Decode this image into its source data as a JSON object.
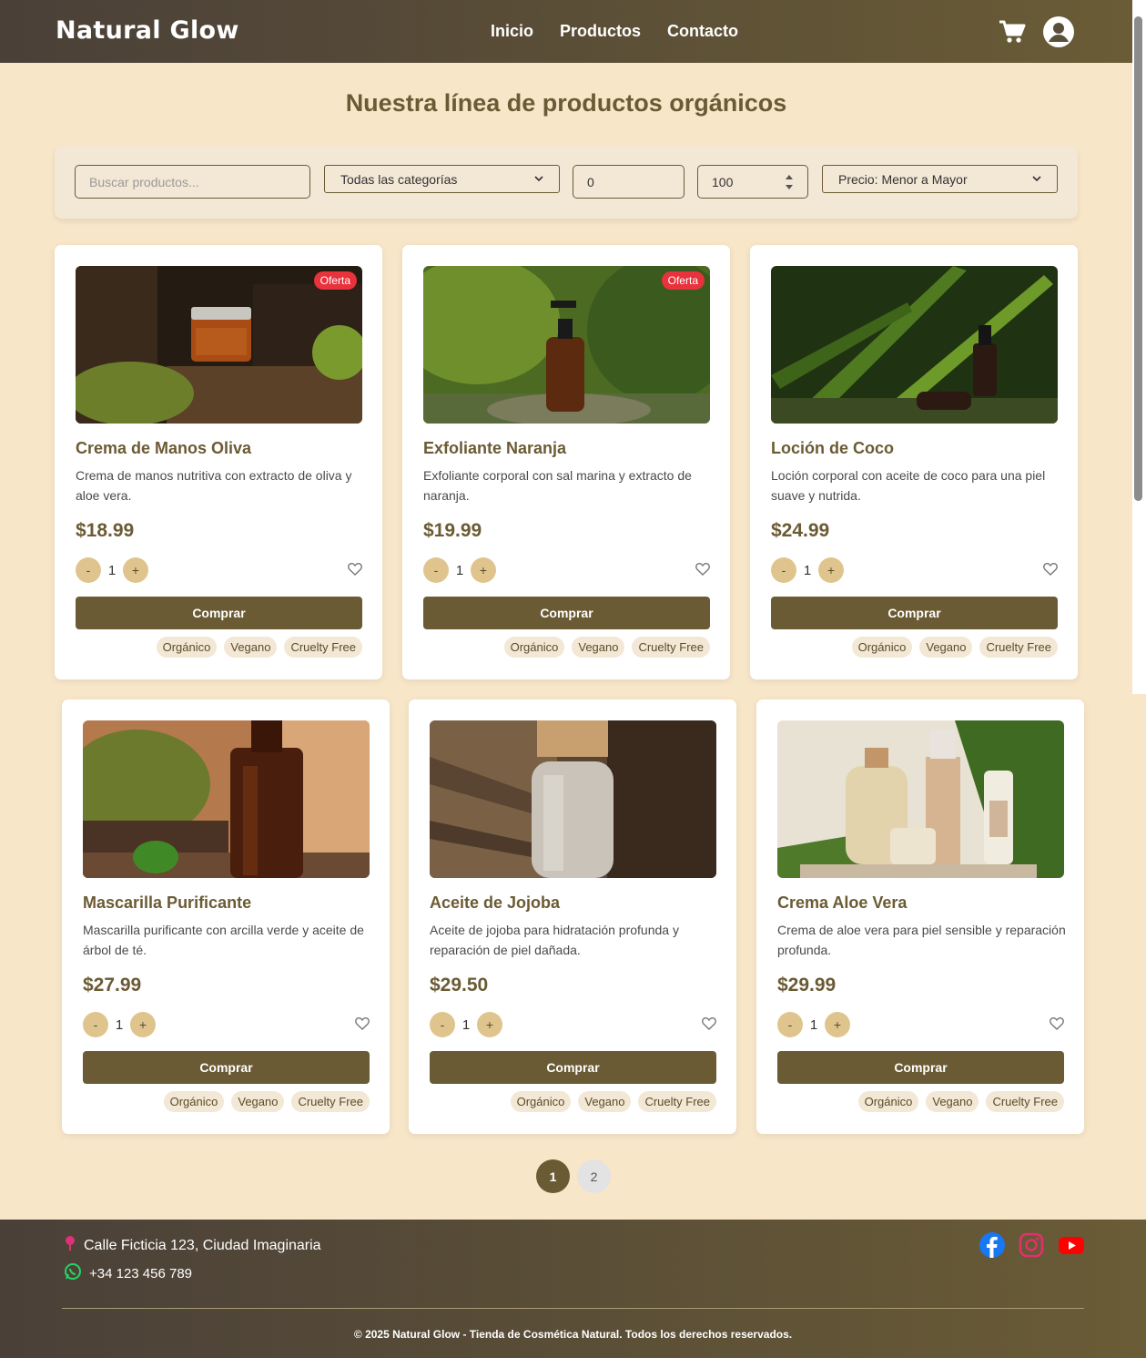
{
  "header": {
    "brand": "Natural Glow",
    "nav": [
      "Inicio",
      "Productos",
      "Contacto"
    ],
    "icons": [
      "cart-icon",
      "user-icon"
    ]
  },
  "page": {
    "title": "Nuestra línea de productos orgánicos"
  },
  "filters": {
    "search_placeholder": "Buscar productos...",
    "category_selected": "Todas las categorías",
    "price_min": "0",
    "price_max": "100",
    "sort_selected": "Precio: Menor a Mayor"
  },
  "products": [
    {
      "name": "Crema de Manos Oliva",
      "desc": "Crema de manos nutritiva con extracto de oliva y aloe vera.",
      "price": "$18.99",
      "qty": "1",
      "badge": "Oferta",
      "buy": "Comprar",
      "tags": [
        "Orgánico",
        "Vegano",
        "Cruelty Free"
      ]
    },
    {
      "name": "Exfoliante Naranja",
      "desc": "Exfoliante corporal con sal marina y extracto de naranja.",
      "price": "$19.99",
      "qty": "1",
      "badge": "Oferta",
      "buy": "Comprar",
      "tags": [
        "Orgánico",
        "Vegano",
        "Cruelty Free"
      ]
    },
    {
      "name": "Loción de Coco",
      "desc": "Loción corporal con aceite de coco para una piel suave y nutrida.",
      "price": "$24.99",
      "qty": "1",
      "badge": "",
      "buy": "Comprar",
      "tags": [
        "Orgánico",
        "Vegano",
        "Cruelty Free"
      ]
    },
    {
      "name": "Mascarilla Purificante",
      "desc": "Mascarilla purificante con arcilla verde y aceite de árbol de té.",
      "price": "$27.99",
      "qty": "1",
      "badge": "",
      "buy": "Comprar",
      "tags": [
        "Orgánico",
        "Vegano",
        "Cruelty Free"
      ]
    },
    {
      "name": "Aceite de Jojoba",
      "desc": "Aceite de jojoba para hidratación profunda y reparación de piel dañada.",
      "price": "$29.50",
      "qty": "1",
      "badge": "",
      "buy": "Comprar",
      "tags": [
        "Orgánico",
        "Vegano",
        "Cruelty Free"
      ]
    },
    {
      "name": "Crema Aloe Vera",
      "desc": "Crema de aloe vera para piel sensible y reparación profunda.",
      "price": "$29.99",
      "qty": "1",
      "badge": "",
      "buy": "Comprar",
      "tags": [
        "Orgánico",
        "Vegano",
        "Cruelty Free"
      ]
    }
  ],
  "qty_controls": {
    "minus": "-",
    "plus": "+"
  },
  "pagination": {
    "pages": [
      "1",
      "2"
    ],
    "current": "1"
  },
  "footer": {
    "address": "Calle Ficticia 123, Ciudad Imaginaria",
    "phone": "+34 123 456 789",
    "social": [
      "facebook-icon",
      "instagram-icon",
      "youtube-icon"
    ],
    "copyright": "© 2025 Natural Glow - Tienda de Cosmética Natural. Todos los derechos reservados."
  },
  "colors": {
    "brand": "#6b5b34",
    "background": "#f8e6c9",
    "badge": "#e8323c",
    "qty_button": "#dfc58d"
  }
}
